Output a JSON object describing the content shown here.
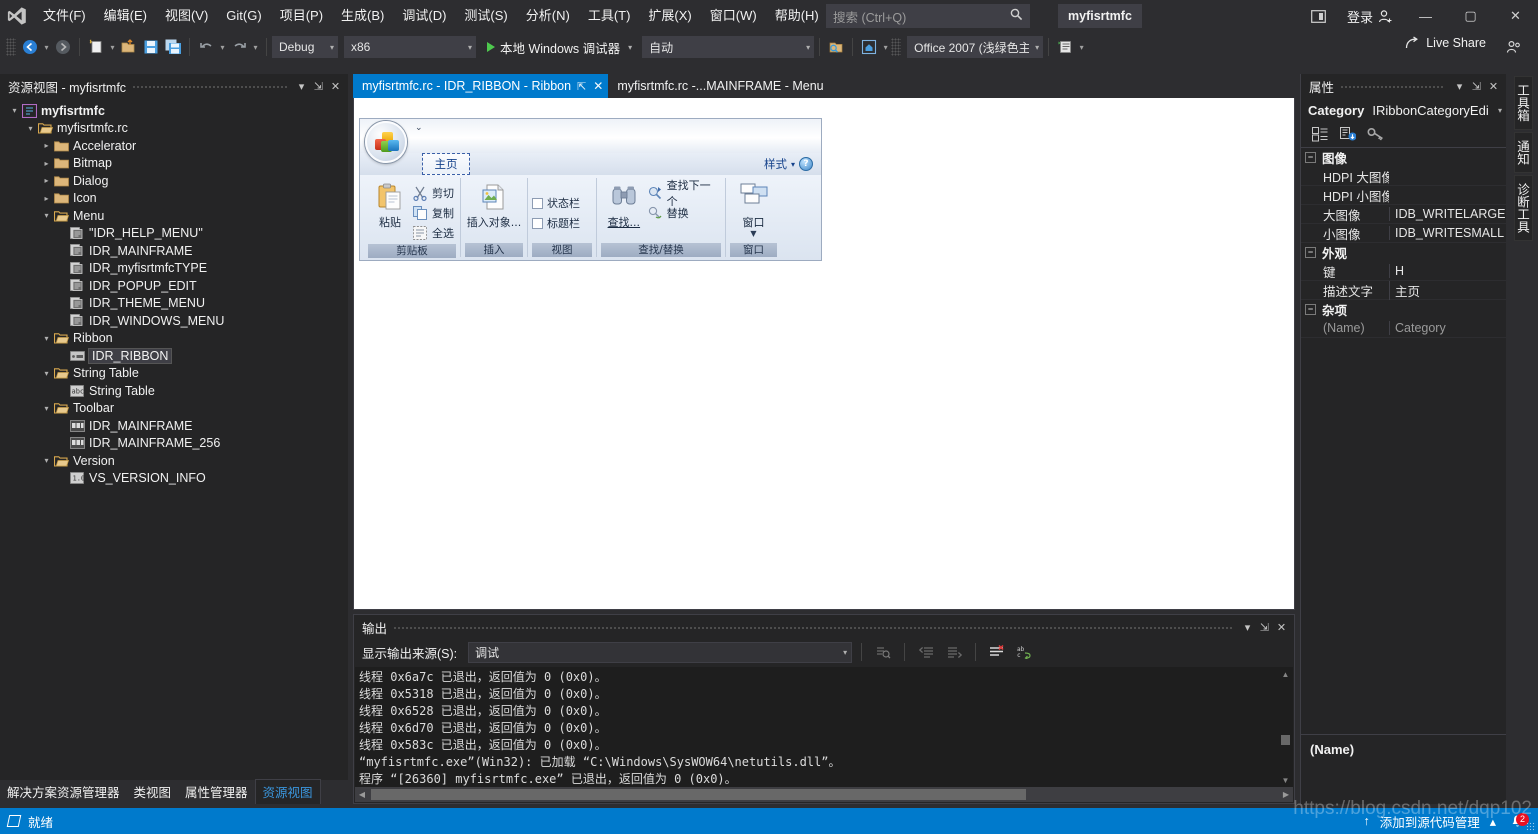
{
  "titlebar": {
    "menu": [
      "文件(F)",
      "编辑(E)",
      "视图(V)",
      "Git(G)",
      "项目(P)",
      "生成(B)",
      "调试(D)",
      "测试(S)",
      "分析(N)",
      "工具(T)",
      "扩展(X)",
      "窗口(W)",
      "帮助(H)"
    ],
    "search_placeholder": "搜索 (Ctrl+Q)",
    "project_chip": "myfisrtmfc",
    "signin_label": "登录",
    "minimize": "—",
    "maximize": "▢",
    "close": "✕"
  },
  "cmdbar": {
    "config": "Debug",
    "platform": "x86",
    "run_label": "本地 Windows 调试器",
    "auto": "自动",
    "theme": "Office 2007 (浅绿色主",
    "live_share": "Live Share"
  },
  "left_panel": {
    "title": "资源视图 - myfisrtmfc",
    "tree": [
      {
        "indent": 0,
        "arrow": "▾",
        "icon": "project-icon",
        "label": "myfisrtmfc",
        "bold": true,
        "selected": false
      },
      {
        "indent": 1,
        "arrow": "▾",
        "icon": "folder-open-icon",
        "label": "myfisrtmfc.rc",
        "bold": false,
        "selected": false
      },
      {
        "indent": 2,
        "arrow": "▸",
        "icon": "folder-icon",
        "label": "Accelerator",
        "bold": false,
        "selected": false
      },
      {
        "indent": 2,
        "arrow": "▸",
        "icon": "folder-icon",
        "label": "Bitmap",
        "bold": false,
        "selected": false
      },
      {
        "indent": 2,
        "arrow": "▸",
        "icon": "folder-icon",
        "label": "Dialog",
        "bold": false,
        "selected": false
      },
      {
        "indent": 2,
        "arrow": "▸",
        "icon": "folder-icon",
        "label": "Icon",
        "bold": false,
        "selected": false
      },
      {
        "indent": 2,
        "arrow": "▾",
        "icon": "folder-open-icon",
        "label": "Menu",
        "bold": false,
        "selected": false
      },
      {
        "indent": 3,
        "arrow": "",
        "icon": "resource-icon",
        "label": "\"IDR_HELP_MENU\"",
        "bold": false,
        "selected": false
      },
      {
        "indent": 3,
        "arrow": "",
        "icon": "resource-icon",
        "label": "IDR_MAINFRAME",
        "bold": false,
        "selected": false
      },
      {
        "indent": 3,
        "arrow": "",
        "icon": "resource-icon",
        "label": "IDR_myfisrtmfcTYPE",
        "bold": false,
        "selected": false
      },
      {
        "indent": 3,
        "arrow": "",
        "icon": "resource-icon",
        "label": "IDR_POPUP_EDIT",
        "bold": false,
        "selected": false
      },
      {
        "indent": 3,
        "arrow": "",
        "icon": "resource-icon",
        "label": "IDR_THEME_MENU",
        "bold": false,
        "selected": false
      },
      {
        "indent": 3,
        "arrow": "",
        "icon": "resource-icon",
        "label": "IDR_WINDOWS_MENU",
        "bold": false,
        "selected": false
      },
      {
        "indent": 2,
        "arrow": "▾",
        "icon": "folder-open-icon",
        "label": "Ribbon",
        "bold": false,
        "selected": false
      },
      {
        "indent": 3,
        "arrow": "",
        "icon": "ribbon-icon",
        "label": "IDR_RIBBON",
        "bold": false,
        "selected": true
      },
      {
        "indent": 2,
        "arrow": "▾",
        "icon": "folder-open-icon",
        "label": "String Table",
        "bold": false,
        "selected": false
      },
      {
        "indent": 3,
        "arrow": "",
        "icon": "abc-icon",
        "label": "String Table",
        "bold": false,
        "selected": false
      },
      {
        "indent": 2,
        "arrow": "▾",
        "icon": "folder-open-icon",
        "label": "Toolbar",
        "bold": false,
        "selected": false
      },
      {
        "indent": 3,
        "arrow": "",
        "icon": "toolbar-icon",
        "label": "IDR_MAINFRAME",
        "bold": false,
        "selected": false
      },
      {
        "indent": 3,
        "arrow": "",
        "icon": "toolbar-icon",
        "label": "IDR_MAINFRAME_256",
        "bold": false,
        "selected": false
      },
      {
        "indent": 2,
        "arrow": "▾",
        "icon": "folder-open-icon",
        "label": "Version",
        "bold": false,
        "selected": false
      },
      {
        "indent": 3,
        "arrow": "",
        "icon": "version-icon",
        "label": "VS_VERSION_INFO",
        "bold": false,
        "selected": false
      }
    ],
    "bottom_tabs": [
      {
        "label": "解决方案资源管理器",
        "active": false
      },
      {
        "label": "类视图",
        "active": false
      },
      {
        "label": "属性管理器",
        "active": false
      },
      {
        "label": "资源视图",
        "active": true
      }
    ]
  },
  "document": {
    "tabs": [
      {
        "label": "myfisrtmfc.rc - IDR_RIBBON - Ribbon",
        "active": true
      },
      {
        "label": "myfisrtmfc.rc -...MAINFRAME - Menu",
        "active": false
      }
    ],
    "ribbon": {
      "tab_label": "主页",
      "style_label": "样式",
      "help_glyph": "?",
      "groups": [
        {
          "title": "剪贴板",
          "big": {
            "label": "粘贴",
            "icon": "paste-icon"
          },
          "small": [
            {
              "label": "剪切",
              "icon": "cut-icon"
            },
            {
              "label": "复制",
              "icon": "copy-icon"
            },
            {
              "label": "全选",
              "icon": "select-all-icon"
            }
          ]
        },
        {
          "title": "插入",
          "big": {
            "label": "插入对象...",
            "icon": "insert-object-icon"
          },
          "small": []
        },
        {
          "title": "视图",
          "big": null,
          "small": [
            {
              "label": "状态栏",
              "icon": "checkbox-icon"
            },
            {
              "label": "标题栏",
              "icon": "checkbox-icon"
            }
          ]
        },
        {
          "title": "查找/替换",
          "big": {
            "label": "查找...",
            "icon": "binoculars-icon"
          },
          "small": [
            {
              "label": "查找下一个",
              "icon": "find-next-icon"
            },
            {
              "label": "替换",
              "icon": "replace-icon"
            }
          ]
        },
        {
          "title": "窗口",
          "big": {
            "label": "窗口",
            "icon": "windows-icon"
          },
          "small": []
        }
      ]
    }
  },
  "output": {
    "title": "输出",
    "source_label": "显示输出来源(S):",
    "source_value": "调试",
    "lines": [
      "线程 0x6a7c 已退出，返回值为 0 (0x0)。",
      "线程 0x5318 已退出，返回值为 0 (0x0)。",
      "线程 0x6528 已退出，返回值为 0 (0x0)。",
      "线程 0x6d70 已退出，返回值为 0 (0x0)。",
      "线程 0x583c 已退出，返回值为 0 (0x0)。",
      "“myfisrtmfc.exe”(Win32): 已加载 “C:\\Windows\\SysWOW64\\netutils.dll”。",
      "程序 “[26360] myfisrtmfc.exe” 已退出，返回值为 0 (0x0)。"
    ]
  },
  "properties": {
    "title": "属性",
    "category_key": "Category",
    "category_value": "IRibbonCategoryEdi",
    "groups": [
      {
        "name": "图像",
        "rows": [
          {
            "name": "HDPI 大图像",
            "value": "",
            "dim": false
          },
          {
            "name": "HDPI 小图像",
            "value": "",
            "dim": false
          },
          {
            "name": "大图像",
            "value": "IDB_WRITELARGE",
            "dim": false
          },
          {
            "name": "小图像",
            "value": "IDB_WRITESMALL",
            "dim": false
          }
        ]
      },
      {
        "name": "外观",
        "rows": [
          {
            "name": "键",
            "value": "H",
            "dim": false
          },
          {
            "name": "描述文字",
            "value": "主页",
            "dim": false
          }
        ]
      },
      {
        "name": "杂项",
        "rows": [
          {
            "name": "(Name)",
            "value": "Category",
            "dim": true
          }
        ]
      }
    ],
    "description_title": "(Name)"
  },
  "vertical_tabs": [
    "工具箱",
    "通知",
    "诊断工具"
  ],
  "statusbar": {
    "ready": "就绪",
    "source_control": "添加到源代码管理",
    "badge_count": "2",
    "watermark": "https://blog.csdn.net/dqp102"
  },
  "colors": {
    "accent": "#007acc",
    "chrome": "#2d2d30",
    "panel": "#252526",
    "editor": "#1e1e1e",
    "folder": "#dcb67a",
    "error": "#e81123"
  }
}
